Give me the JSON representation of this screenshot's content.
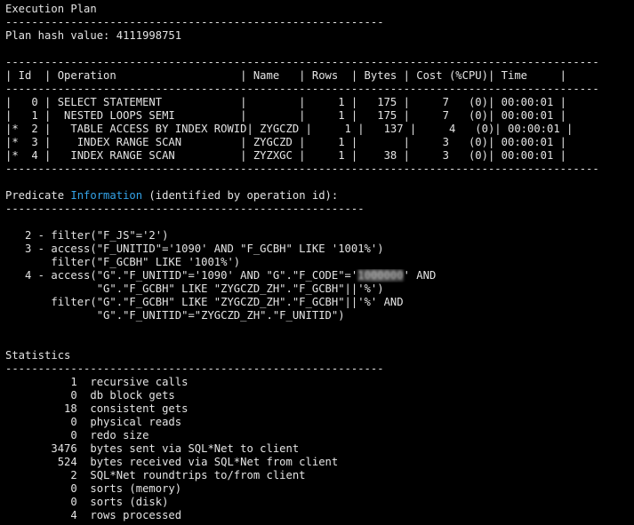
{
  "terminal": {
    "lines": [
      "Execution Plan",
      "----------------------------------------------------------",
      "Plan hash value: 4111998751",
      "",
      "-------------------------------------------------------------------------------------------",
      "| Id  | Operation                   | Name   | Rows  | Bytes | Cost (%CPU)| Time     |",
      "-------------------------------------------------------------------------------------------",
      "|   0 | SELECT STATEMENT            |        |     1 |   175 |     7   (0)| 00:00:01 |",
      "|   1 |  NESTED LOOPS SEMI          |        |     1 |   175 |     7   (0)| 00:00:01 |",
      "|*  2 |   TABLE ACCESS BY INDEX ROWID| ZYGCZD |     1 |   137 |     4   (0)| 00:00:01 |",
      "|*  3 |    INDEX RANGE SCAN         | ZYGCZD |     1 |       |     3   (0)| 00:00:01 |",
      "|*  4 |   INDEX RANGE SCAN          | ZYZXGC |     1 |    38 |     3   (0)| 00:00:01 |",
      "-------------------------------------------------------------------------------------------",
      "",
      "Predicate |Information| (identified by operation id):",
      "-------------------------------------------------------",
      "",
      "   2 - filter(\"F_JS\"='2')",
      "   3 - access(\"F_UNITID\"='1090' AND \"F_GCBH\" LIKE '1001%')",
      "       filter(\"F_GCBH\" LIKE '1001%')",
      "   4 - access(\"G\".\"F_UNITID\"='1090' AND \"G\".\"F_CODE\"='~1000000~' AND",
      "              \"G\".\"F_GCBH\" LIKE \"ZYGCZD_ZH\".\"F_GCBH\"||'%')",
      "       filter(\"G\".\"F_GCBH\" LIKE \"ZYGCZD_ZH\".\"F_GCBH\"||'%' AND",
      "              \"G\".\"F_UNITID\"=\"ZYGCZD_ZH\".\"F_UNITID\")",
      "",
      "",
      "Statistics",
      "----------------------------------------------------------",
      "          1  recursive calls",
      "          0  db block gets",
      "         18  consistent gets",
      "          0  physical reads",
      "          0  redo size",
      "       3476  bytes sent via SQL*Net to client",
      "        524  bytes received via SQL*Net from client",
      "          2  SQL*Net roundtrips to/from client",
      "          0  sorts (memory)",
      "          0  sorts (disk)",
      "          4  rows processed"
    ]
  }
}
